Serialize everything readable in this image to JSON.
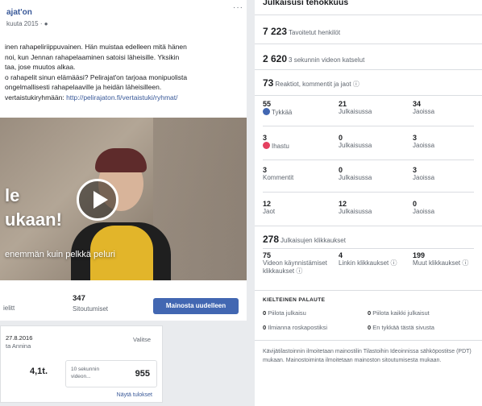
{
  "post": {
    "page_name": "ajat'on",
    "date": "kuuta 2015 · ",
    "more": "···",
    "text_lines": [
      "inen rahapeliriippuvainen. Hän muistaa edelleen mitä hänen",
      "noi, kun Jennan rahapelaaminen satoisi läheisille. Yksikin",
      "taa, jose muutos alkaa.",
      "o rahapelit sinun elämääsi? Pelirajat'on tarjoaa monipuolista",
      "ongelmallisesti rahapelaaville ja heidän läheisilleen.",
      "vertaistukiryhmään: "
    ],
    "link": "http://pelirajaton.fi/vertaistuki/ryhmat/",
    "video": {
      "overlay_line1": "le",
      "overlay_line2": "ukaan!",
      "overlay_line3": "enemmän kuin pelkkä peluri"
    },
    "stats": {
      "a_label": "ielitt",
      "b_value": "347",
      "b_label": "Sitoutumiset",
      "boost_label": "Mainosta uudelleen"
    }
  },
  "card": {
    "date": "27.8.2016",
    "by": "ta Annina",
    "select": "Valitse",
    "big_value": "4,1t.",
    "box_label": "10 sekunnin videon...",
    "box_value": "955",
    "link": "Näytä tulokset"
  },
  "right": {
    "title": "Julkaisusi tehokkuus",
    "reach": {
      "n": "7 223",
      "l": "Tavoitetut henkilöt"
    },
    "views": {
      "n": "2 620",
      "l": "3 sekunnin videon katselut"
    },
    "reactions": {
      "n": "73",
      "l": "Reaktiot, kommentit ja jaot ⓘ"
    },
    "grid": [
      [
        {
          "n": "55",
          "l": "Tykkää",
          "icon": "like"
        },
        {
          "n": "21",
          "l": "Julkaisussa"
        },
        {
          "n": "34",
          "l": "Jaoissa"
        }
      ],
      [
        {
          "n": "3",
          "l": "Ihastu",
          "icon": "love"
        },
        {
          "n": "0",
          "l": "Julkaisussa"
        },
        {
          "n": "3",
          "l": "Jaoissa"
        }
      ],
      [
        {
          "n": "3",
          "l": "Kommentit"
        },
        {
          "n": "0",
          "l": "Julkaisussa"
        },
        {
          "n": "3",
          "l": "Jaoissa"
        }
      ],
      [
        {
          "n": "12",
          "l": "Jaot"
        },
        {
          "n": "12",
          "l": "Julkaisussa"
        },
        {
          "n": "0",
          "l": "Jaoissa"
        }
      ]
    ],
    "clicks": {
      "n": "278",
      "l": "Julkaisujen klikkaukset"
    },
    "click_cells": [
      {
        "n": "75",
        "l": "Videon käynnistämiset klikkaukset ⓘ"
      },
      {
        "n": "4",
        "l": "Linkin klikkaukset ⓘ"
      },
      {
        "n": "199",
        "l": "Muut klikkaukset ⓘ"
      }
    ],
    "neg_title": "KIELTEINEN PALAUTE",
    "negative": [
      {
        "n": "0",
        "l": "Piilota julkaisu"
      },
      {
        "n": "0",
        "l": "Piilota kaikki julkaisut"
      },
      {
        "n": "0",
        "l": "Ilmianna roskapostiksi"
      },
      {
        "n": "0",
        "l": "En tykkää tästä sivusta"
      }
    ],
    "footer": "Kävijätilastoinnin ilmoitetaan mainostilin Tilastoihin Ideoinnissa sähköpostitse (PDT) mukaan. Mainostoiminta ilmoitetaan mainoston sitoutumisesta mukaan."
  },
  "colors": {
    "accent": "#4267b2",
    "link": "#385898",
    "love": "#e4405f"
  }
}
